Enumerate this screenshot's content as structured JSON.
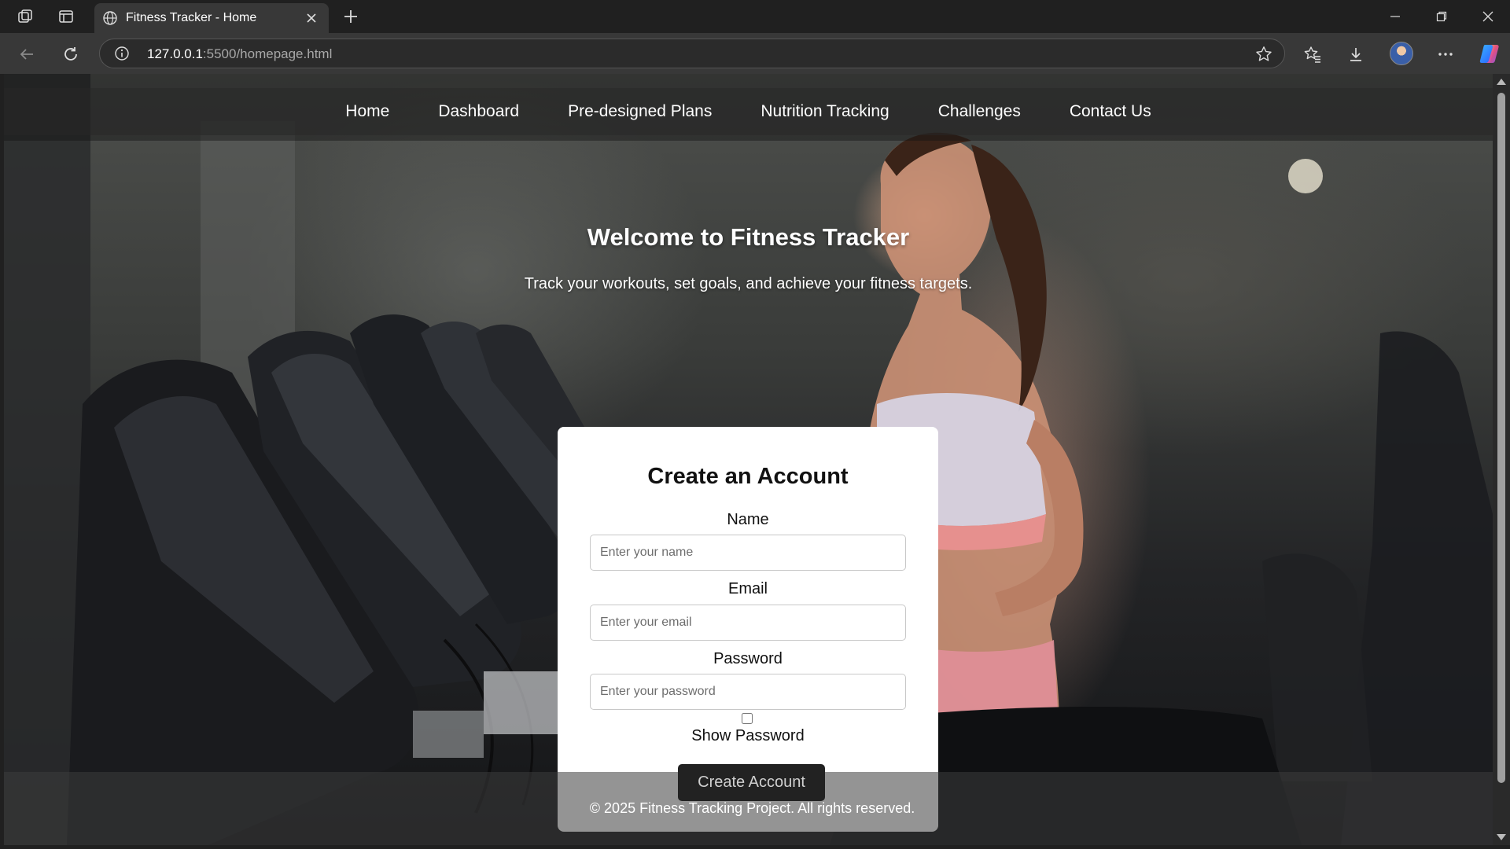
{
  "browser": {
    "tab": {
      "title": "Fitness Tracker - Home"
    },
    "address": {
      "host": "127.0.0.1",
      "path": ":5500/homepage.html"
    },
    "icons": {
      "workspaces": "workspaces-icon",
      "tab_actions": "tab-actions-icon",
      "favicon": "globe-icon",
      "close_tab": "close-icon",
      "new_tab": "plus-icon",
      "minimize": "minimize-icon",
      "maximize": "restore-icon",
      "close_window": "close-icon",
      "back": "back-arrow-icon",
      "refresh": "refresh-icon",
      "site_info": "info-icon",
      "favorite": "star-icon",
      "favorites": "favorites-icon",
      "downloads": "download-icon",
      "profile": "avatar",
      "more": "more-icon",
      "copilot": "copilot-icon"
    }
  },
  "nav": {
    "items": [
      {
        "label": "Home"
      },
      {
        "label": "Dashboard"
      },
      {
        "label": "Pre-designed Plans"
      },
      {
        "label": "Nutrition Tracking"
      },
      {
        "label": "Challenges"
      },
      {
        "label": "Contact Us"
      }
    ]
  },
  "hero": {
    "title": "Welcome to Fitness Tracker",
    "subtitle": "Track your workouts, set goals, and achieve your fitness targets."
  },
  "signup": {
    "title": "Create an Account",
    "name": {
      "label": "Name",
      "placeholder": "Enter your name",
      "value": ""
    },
    "email": {
      "label": "Email",
      "placeholder": "Enter your email",
      "value": ""
    },
    "password": {
      "label": "Password",
      "placeholder": "Enter your password",
      "value": ""
    },
    "show_password": {
      "label": "Show Password",
      "checked": false
    },
    "submit_label": "Create Account"
  },
  "footer": {
    "text": "© 2025 Fitness Tracking Project. All rights reserved."
  },
  "colors": {
    "chrome_bg": "#202020",
    "toolbar_bg": "#383838",
    "card_bg": "#ffffff",
    "button_bg": "#222222"
  }
}
